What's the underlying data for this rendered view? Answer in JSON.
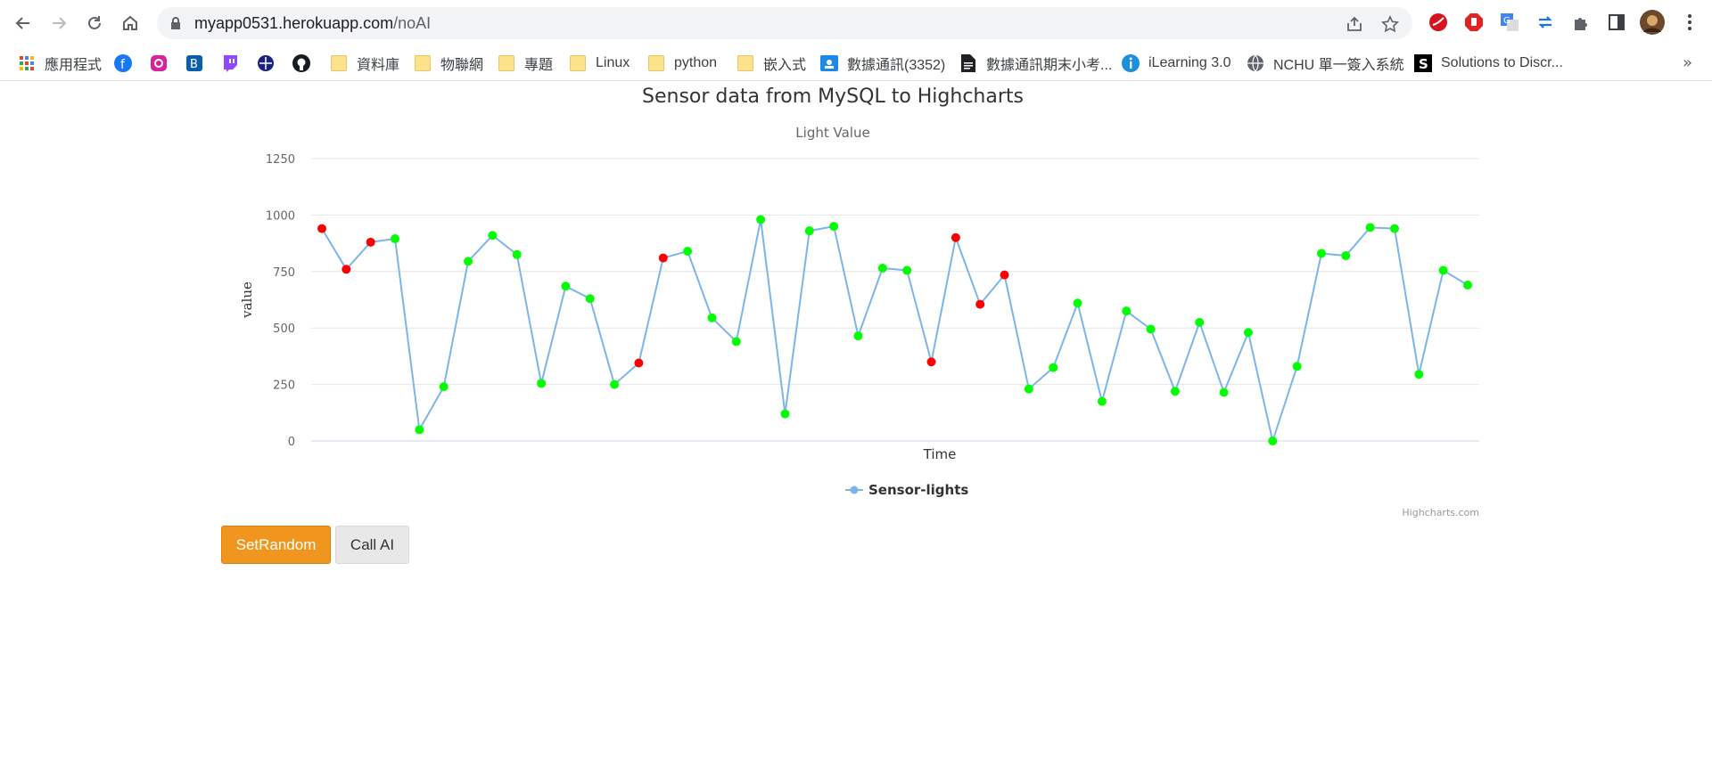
{
  "browser": {
    "url_host": "myapp0531.herokuapp.com",
    "url_path": "/noAI",
    "icons": [
      "back-icon",
      "forward-icon",
      "reload-icon",
      "home-icon",
      "lock-icon",
      "share-icon",
      "bookmark-star-icon",
      "profile-avatar"
    ]
  },
  "bookmarks": [
    {
      "label": "應用程式",
      "icon": "apps-grid-icon"
    },
    {
      "label": "",
      "icon": "facebook-icon"
    },
    {
      "label": "",
      "icon": "instagram-icon"
    },
    {
      "label": "",
      "icon": "bookmark-app-icon"
    },
    {
      "label": "",
      "icon": "twitch-icon"
    },
    {
      "label": "",
      "icon": "site-icon"
    },
    {
      "label": "",
      "icon": "github-icon"
    },
    {
      "label": "資料庫",
      "icon": "folder-icon"
    },
    {
      "label": "物聯網",
      "icon": "folder-icon"
    },
    {
      "label": "專題",
      "icon": "folder-icon"
    },
    {
      "label": "Linux",
      "icon": "folder-icon"
    },
    {
      "label": "python",
      "icon": "folder-icon"
    },
    {
      "label": "嵌入式",
      "icon": "folder-icon"
    },
    {
      "label": "數據通訊(3352)",
      "icon": "classroom-icon"
    },
    {
      "label": "數據通訊期末小考...",
      "icon": "document-icon"
    },
    {
      "label": "iLearning 3.0",
      "icon": "info-icon"
    },
    {
      "label": "NCHU 單一簽入系統",
      "icon": "globe-icon"
    },
    {
      "label": "Solutions to Discr...",
      "icon": "s-logo-icon"
    }
  ],
  "bookmarks_more": "»",
  "chart": {
    "title": "Sensor data from MySQL to Highcharts",
    "subtitle": "Light Value",
    "credits": "Highcharts.com"
  },
  "chart_data": {
    "type": "line",
    "title": "Sensor data from MySQL to Highcharts",
    "subtitle": "Light Value",
    "xlabel": "Time",
    "ylabel": "value",
    "ylim": [
      0,
      1250
    ],
    "yticks": [
      0,
      250,
      500,
      750,
      1000,
      1250
    ],
    "grid": true,
    "legend": "bottom-center",
    "series": [
      {
        "name": "Sensor-lights",
        "color": "#7cb5ec",
        "values": [
          940,
          760,
          880,
          895,
          50,
          240,
          795,
          910,
          825,
          255,
          685,
          630,
          250,
          345,
          810,
          840,
          545,
          440,
          980,
          120,
          930,
          950,
          465,
          765,
          755,
          350,
          900,
          605,
          735,
          230,
          325,
          610,
          175,
          575,
          495,
          220,
          525,
          215,
          480,
          0,
          330,
          830,
          820,
          945,
          940,
          295,
          755,
          690
        ],
        "marker_colors": [
          "#ff0000",
          "#ff0000",
          "#ff0000",
          "#00ff00",
          "#00ff00",
          "#00ff00",
          "#00ff00",
          "#00ff00",
          "#00ff00",
          "#00ff00",
          "#00ff00",
          "#00ff00",
          "#00ff00",
          "#ff0000",
          "#ff0000",
          "#00ff00",
          "#00ff00",
          "#00ff00",
          "#00ff00",
          "#00ff00",
          "#00ff00",
          "#00ff00",
          "#00ff00",
          "#00ff00",
          "#00ff00",
          "#ff0000",
          "#ff0000",
          "#ff0000",
          "#ff0000",
          "#00ff00",
          "#00ff00",
          "#00ff00",
          "#00ff00",
          "#00ff00",
          "#00ff00",
          "#00ff00",
          "#00ff00",
          "#00ff00",
          "#00ff00",
          "#00ff00",
          "#00ff00",
          "#00ff00",
          "#00ff00",
          "#00ff00",
          "#00ff00",
          "#00ff00",
          "#00ff00",
          "#00ff00"
        ]
      }
    ]
  },
  "buttons": {
    "set_random": "SetRandom",
    "call_ai": "Call AI"
  }
}
